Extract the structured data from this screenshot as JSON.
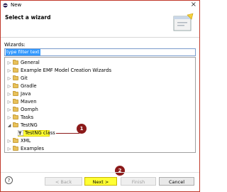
{
  "window": {
    "title": "New"
  },
  "banner": {
    "heading": "Select a wizard"
  },
  "filter": {
    "label": "Wizards:",
    "value": "type filter text"
  },
  "tree": {
    "items": [
      {
        "label": "General",
        "expanded": false
      },
      {
        "label": "Example EMF Model Creation Wizards",
        "expanded": false
      },
      {
        "label": "Git",
        "expanded": false
      },
      {
        "label": "Gradle",
        "expanded": false
      },
      {
        "label": "Java",
        "expanded": false
      },
      {
        "label": "Maven",
        "expanded": false
      },
      {
        "label": "Oomph",
        "expanded": false
      },
      {
        "label": "Tasks",
        "expanded": false
      },
      {
        "label": "TestNG",
        "expanded": true
      },
      {
        "label": "XML",
        "expanded": false
      },
      {
        "label": "Examples",
        "expanded": false
      }
    ],
    "child": {
      "label": "TestNG class"
    }
  },
  "annotations": {
    "step1": "1",
    "step2": "2",
    "color": "#8b1a1a"
  },
  "buttons": {
    "help": "?",
    "back": "< Back",
    "next": "Next >",
    "finish": "Finish",
    "cancel": "Cancel"
  }
}
